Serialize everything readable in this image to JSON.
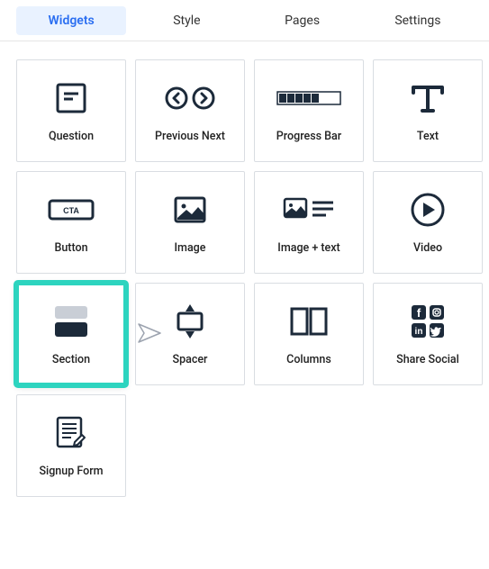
{
  "tabs": [
    {
      "label": "Widgets",
      "active": true
    },
    {
      "label": "Style",
      "active": false
    },
    {
      "label": "Pages",
      "active": false
    },
    {
      "label": "Settings",
      "active": false
    }
  ],
  "widgets": [
    {
      "id": "question",
      "label": "Question"
    },
    {
      "id": "previous-next",
      "label": "Previous Next"
    },
    {
      "id": "progress-bar",
      "label": "Progress Bar"
    },
    {
      "id": "text",
      "label": "Text"
    },
    {
      "id": "button",
      "label": "Button"
    },
    {
      "id": "image",
      "label": "Image"
    },
    {
      "id": "image-text",
      "label": "Image + text"
    },
    {
      "id": "video",
      "label": "Video"
    },
    {
      "id": "section",
      "label": "Section",
      "highlighted": true
    },
    {
      "id": "spacer",
      "label": "Spacer"
    },
    {
      "id": "columns",
      "label": "Columns"
    },
    {
      "id": "share-social",
      "label": "Share Social"
    },
    {
      "id": "signup-form",
      "label": "Signup Form"
    }
  ],
  "colors": {
    "accent": "#2a6ef1",
    "highlight": "#2dd4bf",
    "icon": "#1c2a3a"
  }
}
